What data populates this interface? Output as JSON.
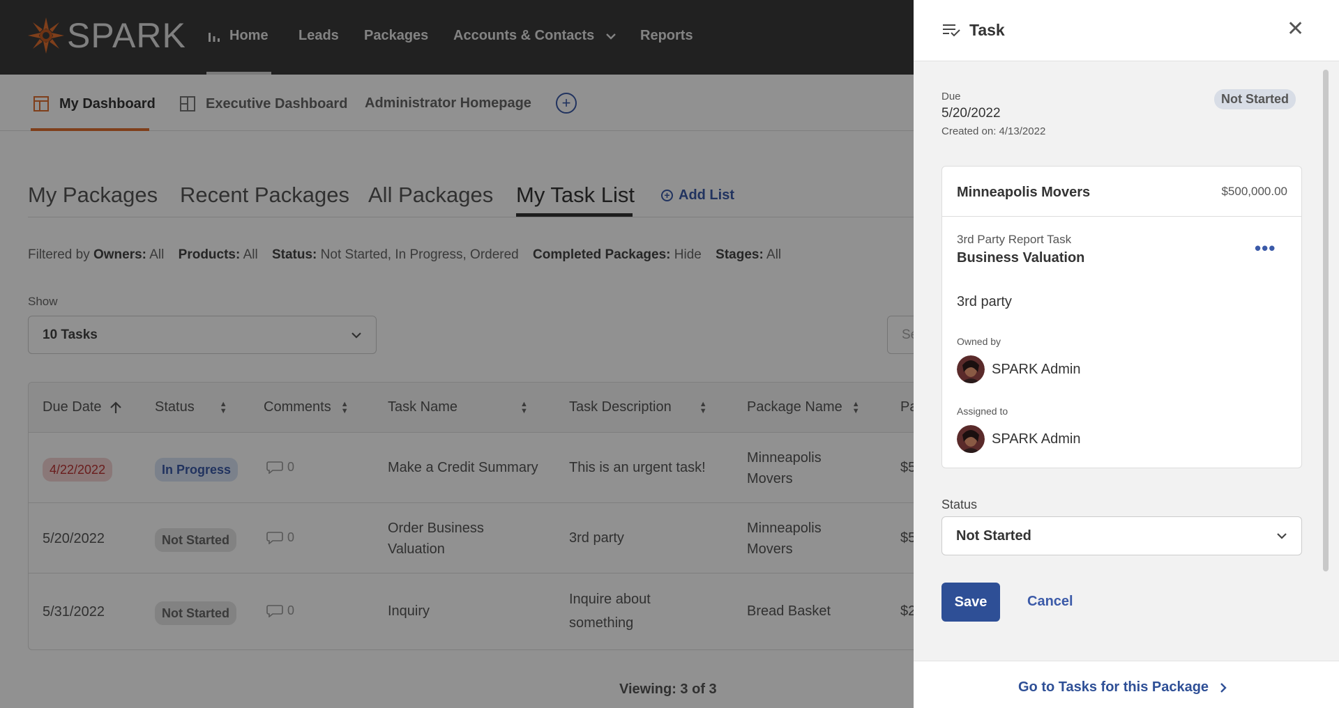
{
  "nav": {
    "logo_text": "SPARK",
    "items": [
      {
        "label": "Home",
        "icon": "bar-chart-icon"
      },
      {
        "label": "Leads"
      },
      {
        "label": "Packages"
      },
      {
        "label": "Accounts & Contacts",
        "icon": "chevron-down-icon"
      },
      {
        "label": "Reports"
      }
    ]
  },
  "subtabs": {
    "my": "My Dashboard",
    "exec": "Executive Dashboard",
    "admin": "Administrator Homepage",
    "add": "+"
  },
  "package_tabs": {
    "my": "My Packages",
    "recent": "Recent Packages",
    "all": "All Packages",
    "task": "My Task List",
    "add_list": "Add List"
  },
  "filters": {
    "prefix": "Filtered by",
    "owners_label": "Owners:",
    "owners_value": "All",
    "products_label": "Products:",
    "products_value": "All",
    "status_label": "Status:",
    "status_value": "Not Started, In Progress, Ordered",
    "completed_label": "Completed Packages:",
    "completed_value": "Hide",
    "stages_label": "Stages:",
    "stages_value": "All"
  },
  "show": {
    "label": "Show",
    "value": "10 Tasks",
    "search_placeholder": "Se"
  },
  "table": {
    "headers": [
      "Due Date",
      "Status",
      "Comments",
      "Task Name",
      "Task Description",
      "Package Name",
      "Pa"
    ],
    "rows": [
      {
        "due": "4/22/2022",
        "status": "In Progress",
        "comments": "0",
        "task": "Make a Credit Summary",
        "desc": "This is an urgent task!",
        "pkg1": "Minneapolis",
        "pkg2": "Movers",
        "amount": "$5"
      },
      {
        "due": "5/20/2022",
        "status": "Not Started",
        "comments": "0",
        "task1": "Order Business",
        "task2": "Valuation",
        "desc": "3rd party",
        "pkg1": "Minneapolis",
        "pkg2": "Movers",
        "amount": "$5"
      },
      {
        "due": "5/31/2022",
        "status": "Not Started",
        "comments": "0",
        "task": "Inquiry",
        "desc1": "Inquire about",
        "desc2": "something",
        "pkg": "Bread Basket",
        "amount": "$2"
      }
    ],
    "viewing": "Viewing: 3 of 3"
  },
  "panel": {
    "title": "Task",
    "due_label": "Due",
    "due_date": "5/20/2022",
    "created": "Created on: 4/13/2022",
    "status_badge": "Not Started",
    "card": {
      "package_name": "Minneapolis Movers",
      "amount": "$500,000.00",
      "task_type": "3rd Party Report Task",
      "task_name": "Business Valuation",
      "description": "3rd party",
      "owned_label": "Owned by",
      "owner": "SPARK Admin",
      "assigned_label": "Assigned to",
      "assignee": "SPARK Admin"
    },
    "status_label": "Status",
    "status_value": "Not Started",
    "save": "Save",
    "cancel": "Cancel",
    "footer_link": "Go to Tasks for this Package"
  },
  "colors": {
    "nav_bg": "#3a3a3a",
    "accent_orange": "#e07030",
    "primary_blue": "#2e4f96"
  }
}
